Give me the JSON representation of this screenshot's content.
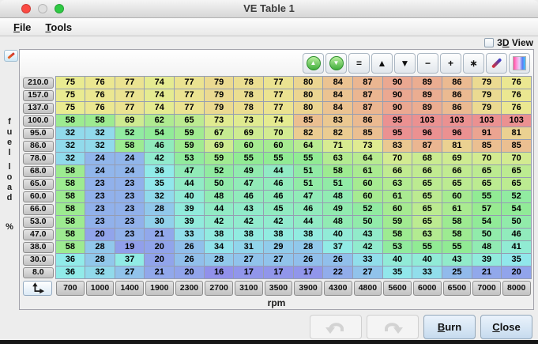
{
  "window": {
    "title": "VE Table 1",
    "traffic_light_colors": [
      "#fb4a43",
      "#dfdfdf",
      "#2fc944"
    ]
  },
  "menubar": {
    "items": [
      {
        "label": "File"
      },
      {
        "label": "Tools"
      }
    ]
  },
  "view_3d": {
    "pre": "3",
    "accel": "D",
    "rest": " View",
    "checked": false
  },
  "toolbar": {
    "buttons": [
      {
        "name": "green-up-button",
        "type": "circle-up",
        "icon": "green-circle-up-arrow-icon"
      },
      {
        "name": "green-down-button",
        "type": "circle-down",
        "icon": "green-circle-down-arrow-icon"
      },
      {
        "name": "equals-button",
        "type": "glyph",
        "glyph": "="
      },
      {
        "name": "triangle-up-button",
        "type": "glyph",
        "glyph": "▲"
      },
      {
        "name": "triangle-down-button",
        "type": "glyph",
        "glyph": "▼"
      },
      {
        "name": "minus-button",
        "type": "glyph",
        "glyph": "−"
      },
      {
        "name": "plus-button",
        "type": "glyph",
        "glyph": "+"
      },
      {
        "name": "asterisk-button",
        "type": "glyph",
        "glyph": "∗"
      },
      {
        "name": "pencil-button",
        "type": "pencil",
        "icon": "pencil-icon"
      },
      {
        "name": "gradient-button",
        "type": "gradient",
        "icon": "color-gradient-icon"
      }
    ]
  },
  "table": {
    "y_axis_label": "fuel load %",
    "x_axis_label": "rpm",
    "row_headers": [
      "210.0",
      "157.0",
      "137.0",
      "100.0",
      "95.0",
      "86.0",
      "78.0",
      "68.0",
      "65.0",
      "60.0",
      "66.0",
      "53.0",
      "47.0",
      "38.0",
      "30.0",
      "8.0"
    ],
    "col_headers": [
      "700",
      "1000",
      "1400",
      "1900",
      "2300",
      "2700",
      "3100",
      "3500",
      "3900",
      "4300",
      "4800",
      "5600",
      "6000",
      "6500",
      "7000",
      "8000"
    ],
    "values": [
      [
        75,
        76,
        77,
        74,
        77,
        79,
        78,
        77,
        80,
        84,
        87,
        90,
        89,
        86,
        79,
        76
      ],
      [
        75,
        76,
        77,
        74,
        77,
        79,
        78,
        77,
        80,
        84,
        87,
        90,
        89,
        86,
        79,
        76
      ],
      [
        75,
        76,
        77,
        74,
        77,
        79,
        78,
        77,
        80,
        84,
        87,
        90,
        89,
        86,
        79,
        76
      ],
      [
        58,
        58,
        69,
        62,
        65,
        73,
        73,
        74,
        85,
        83,
        86,
        95,
        103,
        103,
        103,
        103
      ],
      [
        32,
        32,
        52,
        54,
        59,
        67,
        69,
        70,
        82,
        82,
        85,
        95,
        96,
        96,
        91,
        81
      ],
      [
        32,
        32,
        58,
        46,
        59,
        69,
        60,
        60,
        64,
        71,
        73,
        83,
        87,
        81,
        85,
        85
      ],
      [
        32,
        24,
        24,
        42,
        53,
        59,
        55,
        55,
        55,
        63,
        64,
        70,
        68,
        69,
        70,
        70
      ],
      [
        58,
        24,
        24,
        36,
        47,
        52,
        49,
        44,
        51,
        58,
        61,
        66,
        66,
        66,
        65,
        65
      ],
      [
        58,
        23,
        23,
        35,
        44,
        50,
        47,
        46,
        51,
        51,
        60,
        63,
        65,
        65,
        65,
        65
      ],
      [
        58,
        23,
        23,
        32,
        40,
        48,
        46,
        46,
        47,
        48,
        60,
        61,
        65,
        60,
        55,
        52
      ],
      [
        58,
        23,
        23,
        28,
        39,
        44,
        43,
        45,
        46,
        49,
        52,
        60,
        65,
        61,
        57,
        54
      ],
      [
        58,
        23,
        23,
        30,
        39,
        42,
        42,
        42,
        44,
        48,
        50,
        59,
        65,
        58,
        54,
        50
      ],
      [
        58,
        20,
        23,
        21,
        33,
        38,
        38,
        38,
        38,
        40,
        43,
        58,
        63,
        58,
        50,
        46
      ],
      [
        58,
        28,
        19,
        20,
        26,
        34,
        31,
        29,
        28,
        37,
        42,
        53,
        55,
        55,
        48,
        41
      ],
      [
        36,
        28,
        37,
        20,
        26,
        28,
        27,
        27,
        26,
        26,
        33,
        40,
        40,
        43,
        39,
        35
      ],
      [
        36,
        32,
        27,
        21,
        20,
        16,
        17,
        17,
        17,
        22,
        27,
        35,
        33,
        25,
        21,
        20
      ]
    ]
  },
  "heatmap": {
    "min": 16,
    "max": 95,
    "hue_low_deg": 240,
    "hue_high_deg": 0,
    "saturation": 0.38,
    "brightness": 0.92
  },
  "bottom_bar": {
    "burn_label": "Burn",
    "close_label": "Close"
  }
}
